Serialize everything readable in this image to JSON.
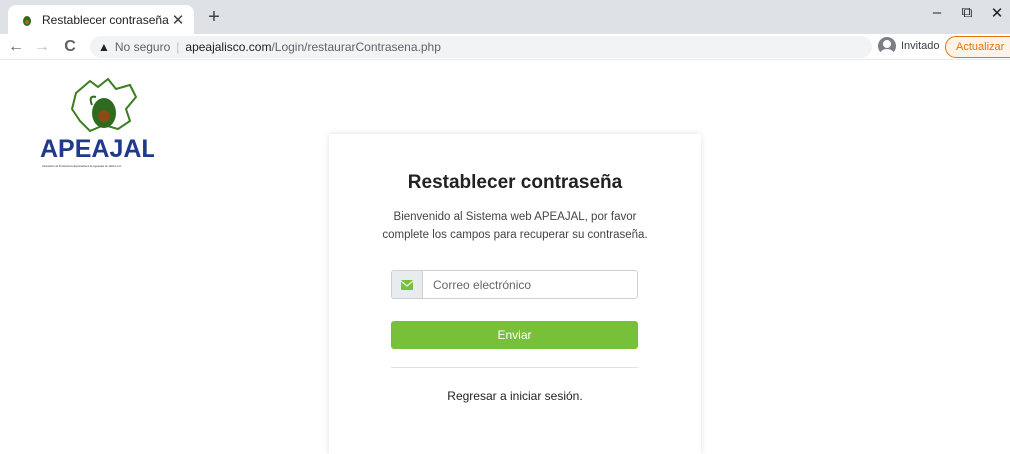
{
  "browser": {
    "tab": {
      "title": "Restablecer contraseña",
      "close_glyph": "✕",
      "favicon": "apeajal-favicon-icon"
    },
    "new_tab_glyph": "+",
    "window_controls": {
      "minimize": "–",
      "restore": "⧉",
      "close": "✕"
    },
    "nav": {
      "back": "←",
      "forward": "→",
      "reload": "C"
    },
    "address": {
      "warning_glyph": "▲",
      "security_text": "No seguro",
      "separator": "|",
      "host": "apeajalisco.com",
      "path": "/Login/restaurarContrasena.php"
    },
    "profile": {
      "label": "Invitado"
    },
    "update": {
      "label": "Actualizar",
      "menu_glyph": "⋮"
    }
  },
  "page": {
    "logo": {
      "text": "APEAJAL",
      "fine_print": "Asociación de Productores Exportadores de Aguacate de Jalisco A.C."
    },
    "card": {
      "title": "Restablecer contraseña",
      "intro": "Bienvenido al Sistema web APEAJAL, por favor complete los campos para recuperar su contraseña.",
      "email": {
        "value": "",
        "placeholder": "Correo electrónico"
      },
      "submit_label": "Enviar",
      "back_link": "Regresar a iniciar sesión."
    }
  },
  "colors": {
    "accent": "#79c03a",
    "update_orange": "#e8710a",
    "logo_blue": "#1f3a8a",
    "logo_green": "#5aa02c"
  }
}
